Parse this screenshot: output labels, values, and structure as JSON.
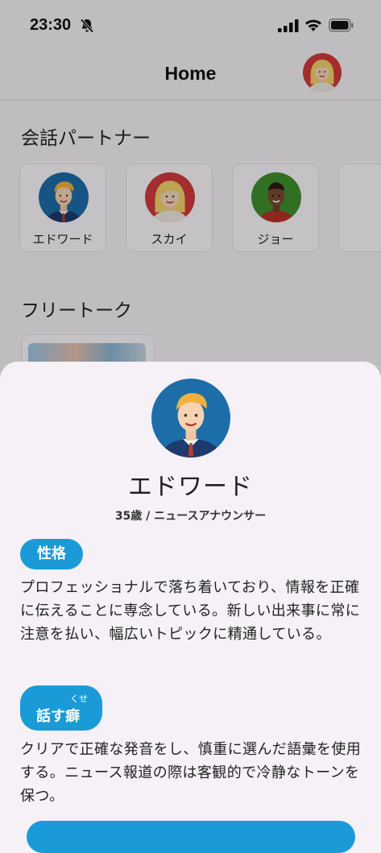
{
  "status": {
    "time": "23:30"
  },
  "header": {
    "title": "Home"
  },
  "sections": {
    "partners_title": "会話パートナー",
    "free_talk_title": "フリートーク"
  },
  "partners": [
    {
      "name": "エドワード"
    },
    {
      "name": "スカイ"
    },
    {
      "name": "ジョー"
    }
  ],
  "sheet": {
    "name": "エドワード",
    "subtitle": "35歳 / ニュースアナウンサー",
    "personality_label": "性格",
    "personality_text": "プロフェッショナルで落ち着いており、情報を正確に伝えることに専念している。新しい出来事に常に注意を払い、幅広いトピックに精通している。",
    "habit_label": "話す癖",
    "habit_ruby": "くせ",
    "habit_text": "クリアで正確な発音をし、慎重に選んだ語彙を使用する。ニュース報道の際は客観的で冷静なトーンを保つ。"
  },
  "colors": {
    "accent": "#1a9bd7",
    "sheet_bg": "#f5f1f7"
  },
  "icons": [
    "bell-slash-icon",
    "cellular-signal-icon",
    "wifi-icon",
    "battery-icon"
  ]
}
